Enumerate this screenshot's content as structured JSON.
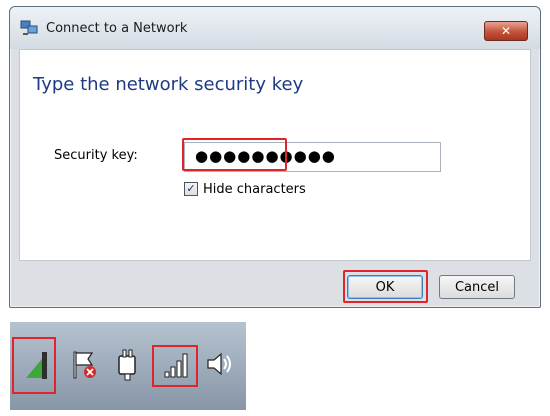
{
  "window": {
    "title": "Connect to a Network",
    "close_label": "✕"
  },
  "form": {
    "heading": "Type the network security key",
    "key_label": "Security key:",
    "key_value": "●●●●●●●●●●",
    "hide_characters_label": "Hide characters",
    "hide_characters_checked": true,
    "check_glyph": "✓"
  },
  "buttons": {
    "ok_label": "OK",
    "cancel_label": "Cancel"
  },
  "tray": {
    "icons": [
      "wireless-signal-icon",
      "action-center-flag-icon",
      "network-plug-icon",
      "signal-bars-icon",
      "speaker-icon"
    ],
    "highlight_color": "#e0242b",
    "signal_color": "#3da83a"
  }
}
